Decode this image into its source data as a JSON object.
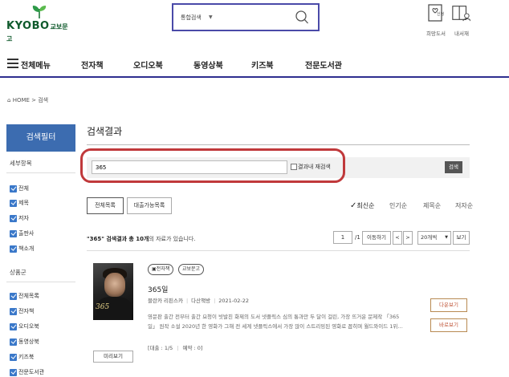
{
  "header": {
    "logo_text": "KYOBO",
    "logo_sub": "교보문고",
    "search_scope": "통합검색",
    "icons": [
      {
        "name": "wishlist-icon",
        "label": "희망도서",
        "badge": "신청"
      },
      {
        "name": "my-library-icon",
        "label": "내서재"
      }
    ]
  },
  "nav": {
    "items": [
      "전체메뉴",
      "전자책",
      "오디오북",
      "동영상북",
      "키즈북",
      "전문도서관"
    ]
  },
  "breadcrumb": "HOME > 검색",
  "sidebar": {
    "filter_title": "검색필터",
    "section1_title": "세부항목",
    "section1_items": [
      "전체",
      "제목",
      "저자",
      "출판사",
      "책소개"
    ],
    "section2_title": "상품군",
    "section2_items": [
      "전체목록",
      "전자책",
      "오디오북",
      "동영상북",
      "키즈북",
      "전문도서관"
    ]
  },
  "main": {
    "title": "검색결과",
    "search_value": "365",
    "recheck_label": "결과내 재검색",
    "search_button": "검색",
    "tabs": [
      "전체목록",
      "대출가능목록"
    ],
    "sort_options": [
      "최신순",
      "인기순",
      "제목순",
      "저자순"
    ],
    "sort_selected_mark": "✓",
    "count_prefix": "\"365\" 검색결과",
    "count_total": "총 10개",
    "count_suffix": "의 자료가 있습니다.",
    "page_current": "1",
    "page_total": "/1",
    "move_label": "이동하기",
    "prev_label": "<",
    "next_label": ">",
    "per_page": "20개씩",
    "view_label": "보기"
  },
  "item": {
    "cover_text": "365",
    "preview_label": "미리보기",
    "badges": [
      "전자책",
      "교보문고"
    ],
    "title": "365일",
    "author": "블란카 리핀스카",
    "publisher": "다산책방",
    "date": "2021-02-22",
    "desc_line1": "영문판 출간 전부터 출간 요청이 빗발친 화제의 도서 넷플릭스 심의 통과만 두 달이 걸린, 가장 뜨거운 문제작 「365",
    "desc_line2": "일」 원작 소설 2020년 한 영화가 그해 전 세계 넷플릭스에서 가장 많이 스트리밍된 영화로 꼽히며 월드와이드 1위…",
    "loan": "[대출 : 1/5",
    "reserve": "예약 : 0]",
    "download_label": "다운보기",
    "read_label": "바로보기"
  }
}
